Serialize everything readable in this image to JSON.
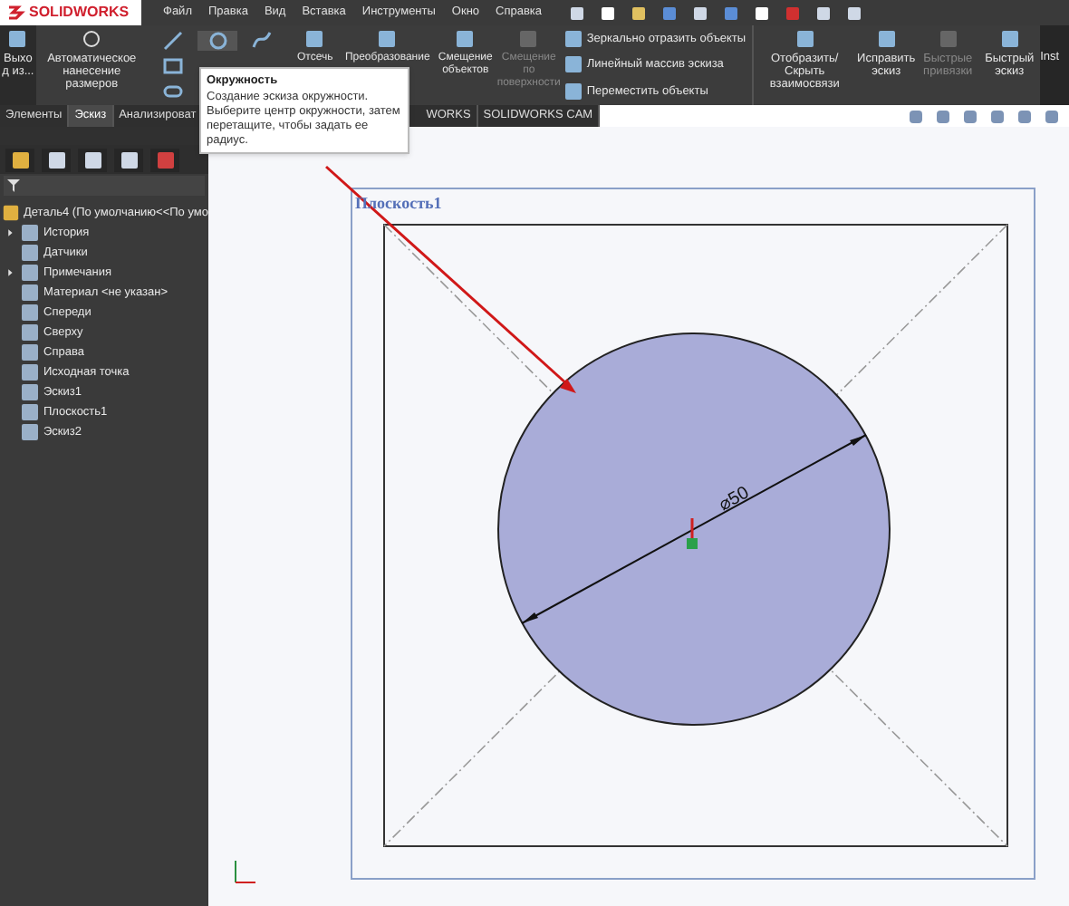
{
  "app": {
    "logo": "SOLIDWORKS"
  },
  "menu": [
    "Файл",
    "Правка",
    "Вид",
    "Вставка",
    "Инструменты",
    "Окно",
    "Справка"
  ],
  "ribbon": {
    "exit": "Выхо д из...",
    "auto_dim": "Автоматическое нанесение размеров",
    "tools": [
      {
        "label": "Отсечь",
        "disabled": false
      },
      {
        "label": "Преобразование",
        "disabled": false
      },
      {
        "label": "Смещение объектов",
        "disabled": false
      },
      {
        "label": "Смещение по поверхности",
        "disabled": true
      }
    ],
    "list": [
      "Зеркально отразить объекты",
      "Линейный массив эскиза",
      "Переместить объекты"
    ],
    "right": [
      {
        "label": "Отобразить/Скрыть взаимосвязи",
        "disabled": false
      },
      {
        "label": "Исправить эскиз",
        "disabled": false
      },
      {
        "label": "Быстрые привязки",
        "disabled": true
      },
      {
        "label": "Быстрый эскиз",
        "disabled": false
      }
    ],
    "cut": "Inst"
  },
  "tabs": [
    {
      "label": "Элементы",
      "selected": false
    },
    {
      "label": "Эскиз",
      "selected": true
    },
    {
      "label": "Анализироват",
      "selected": false
    },
    {
      "label": "WORKS",
      "selected": false
    },
    {
      "label": "SOLIDWORKS CAM",
      "selected": false
    }
  ],
  "tooltip": {
    "title": "Окружность",
    "text": "Создание эскиза окружности. Выберите центр окружности, затем перетащите, чтобы задать ее радиус."
  },
  "tree": {
    "label": "Деталь4  (По умолчанию<<По умо",
    "children": [
      {
        "label": "История",
        "expandable": true
      },
      {
        "label": "Датчики",
        "expandable": false
      },
      {
        "label": "Примечания",
        "expandable": true
      },
      {
        "label": "Материал <не указан>",
        "expandable": false
      },
      {
        "label": "Спереди",
        "expandable": false
      },
      {
        "label": "Сверху",
        "expandable": false
      },
      {
        "label": "Справа",
        "expandable": false
      },
      {
        "label": "Исходная точка",
        "expandable": false
      },
      {
        "label": "Эскиз1",
        "expandable": false
      },
      {
        "label": "Плоскость1",
        "expandable": false
      },
      {
        "label": "Эскиз2",
        "expandable": false
      }
    ]
  },
  "canvas": {
    "plane_label": "Плоскость1",
    "dimension": "⌀50"
  }
}
